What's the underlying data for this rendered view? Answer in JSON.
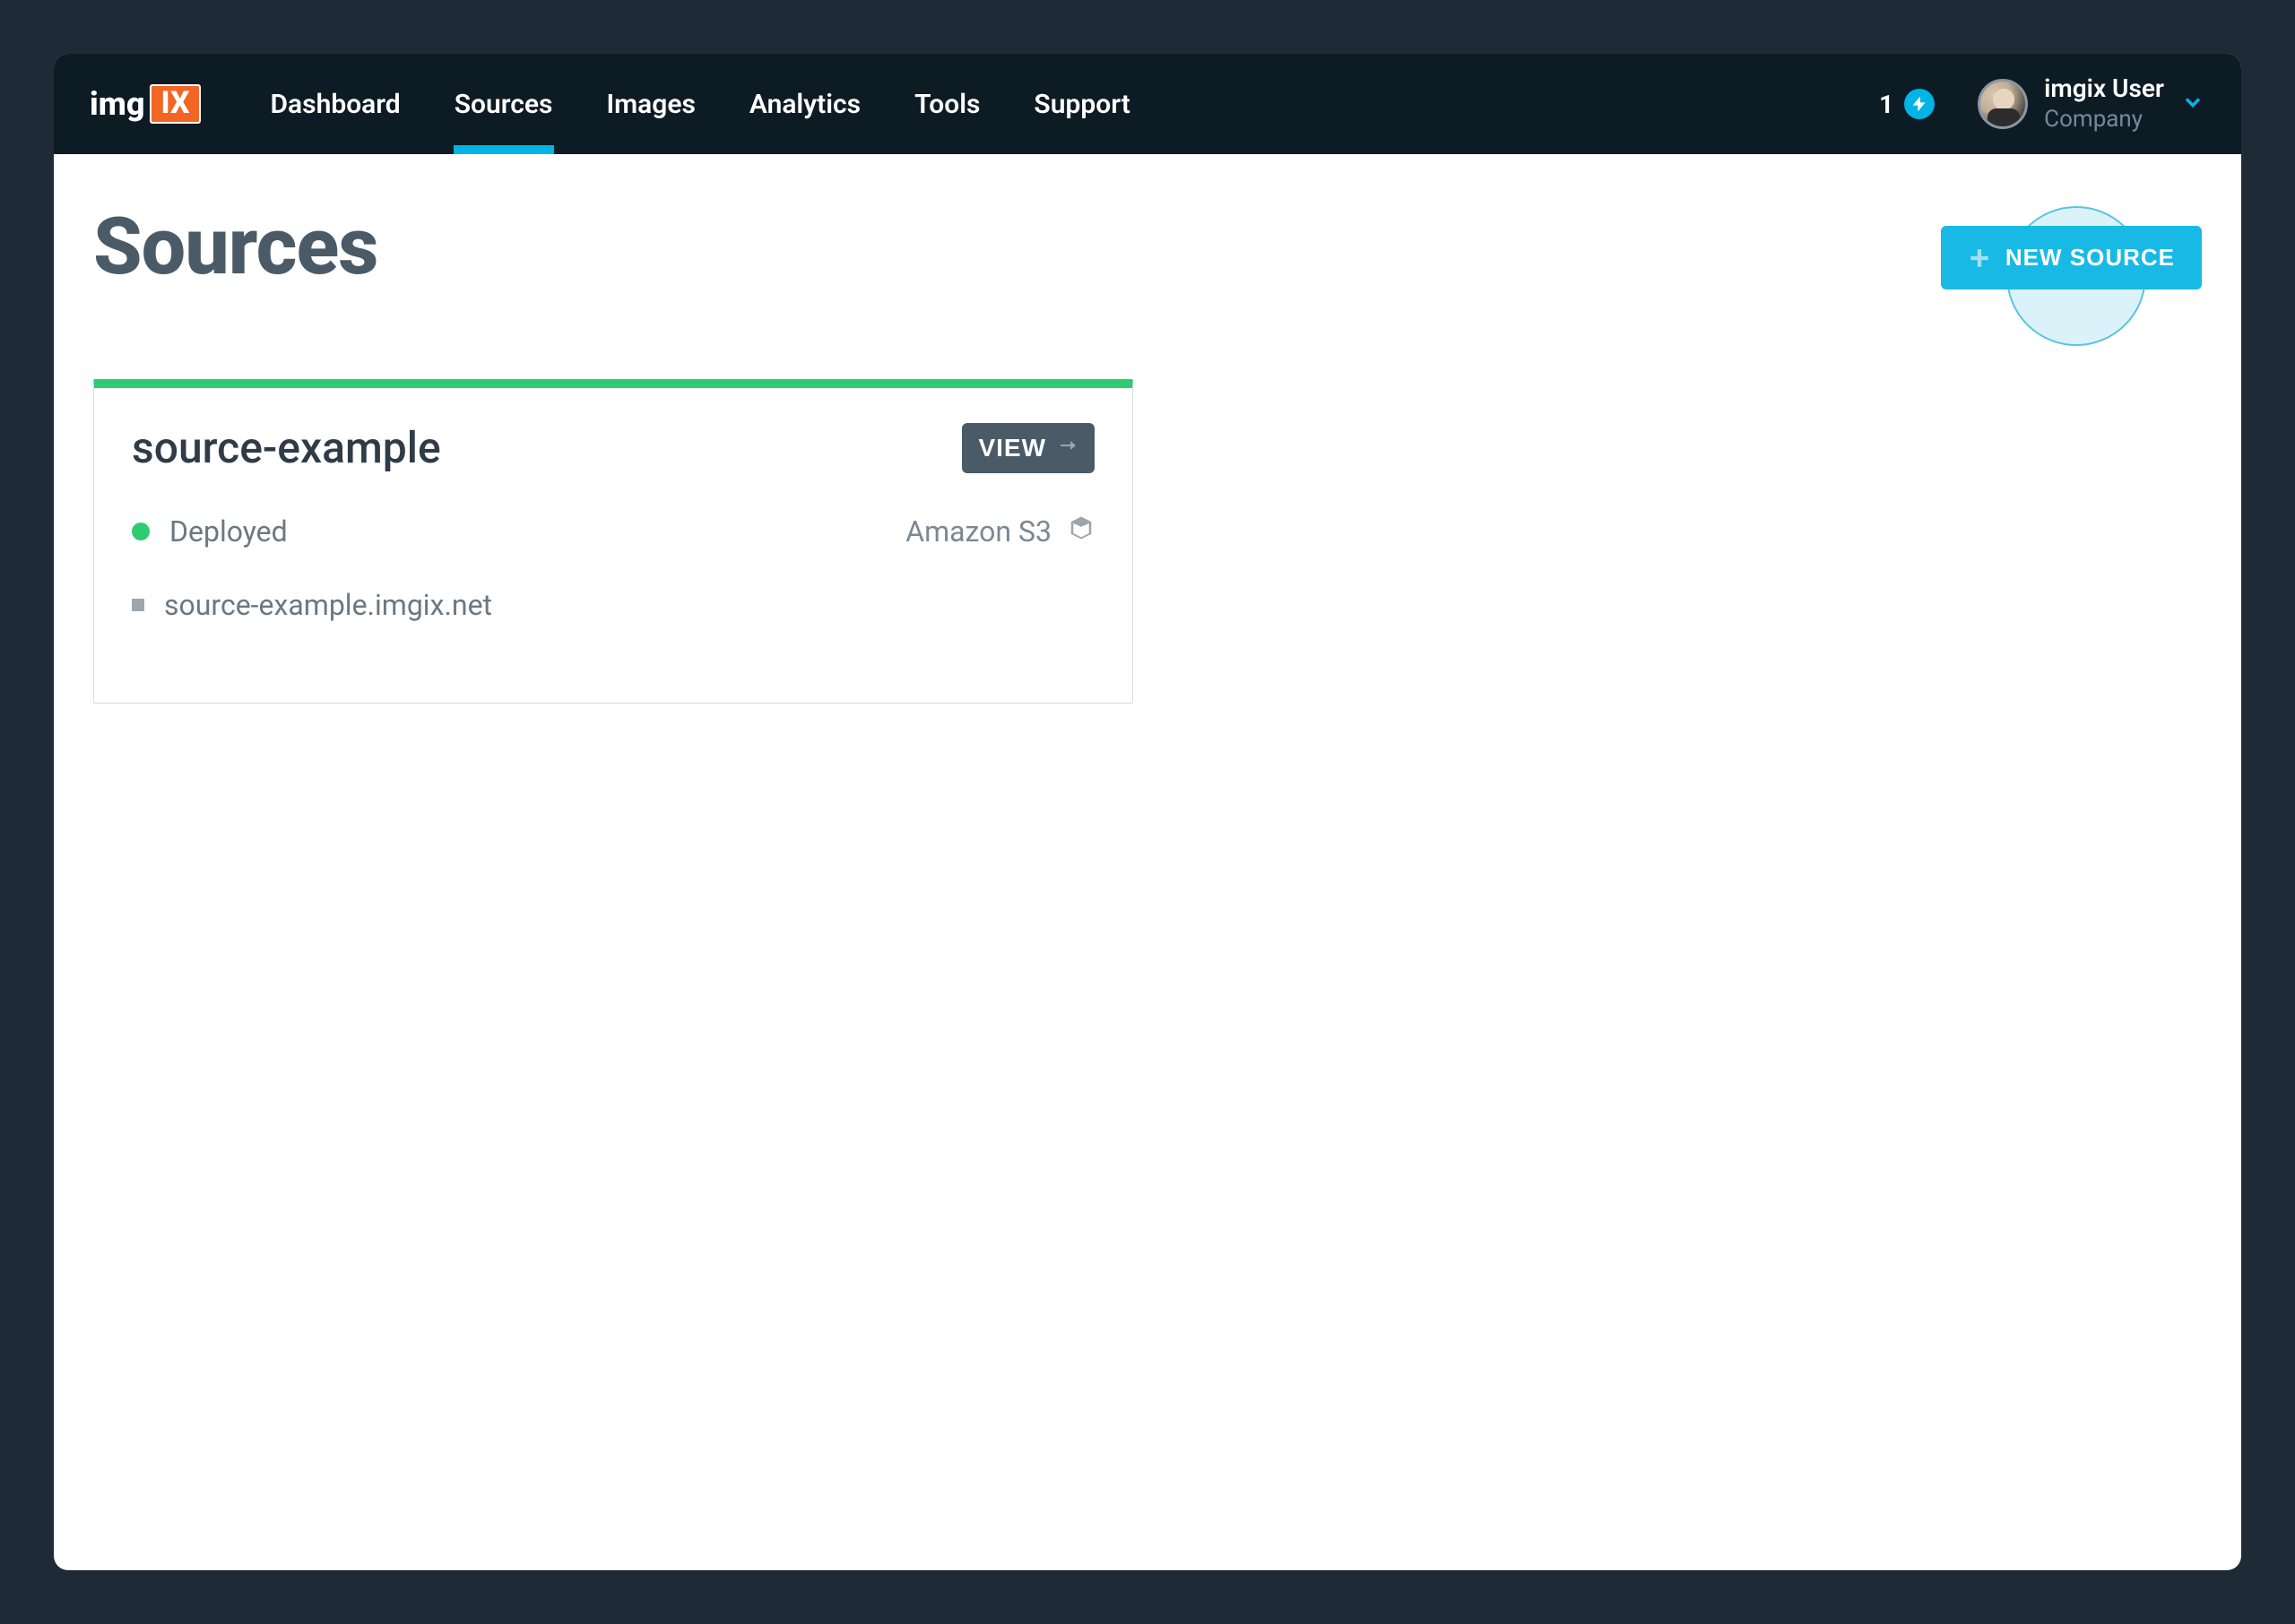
{
  "nav": {
    "items": [
      {
        "label": "Dashboard",
        "active": false
      },
      {
        "label": "Sources",
        "active": true
      },
      {
        "label": "Images",
        "active": false
      },
      {
        "label": "Analytics",
        "active": false
      },
      {
        "label": "Tools",
        "active": false
      },
      {
        "label": "Support",
        "active": false
      }
    ]
  },
  "notifications": {
    "count": "1"
  },
  "user": {
    "name": "imgix User",
    "company": "Company"
  },
  "page": {
    "title": "Sources",
    "new_source_label": "NEW SOURCE"
  },
  "sources": [
    {
      "name": "source-example",
      "view_label": "VIEW",
      "status": "Deployed",
      "provider": "Amazon S3",
      "domain": "source-example.imgix.net"
    }
  ]
}
